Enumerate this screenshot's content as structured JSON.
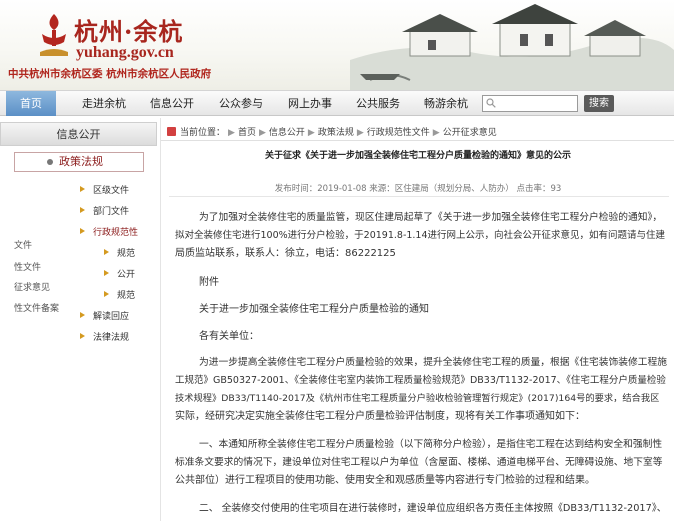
{
  "header": {
    "logo_title": "杭州·余杭",
    "logo_domain": "yuhang.gov.cn",
    "subtitle": "中共杭州市余杭区委  杭州市余杭区人民政府"
  },
  "nav": {
    "items": [
      "首页",
      "走进余杭",
      "信息公开",
      "公众参与",
      "网上办事",
      "公共服务",
      "畅游余杭"
    ],
    "search_button": "搜索"
  },
  "sidebar": {
    "title": "信息公开",
    "selected": "政策法规",
    "links": [
      "区级文件",
      "部门文件",
      "行政规范性",
      "规范",
      "公开",
      "规范",
      "解读回应",
      "法律法规"
    ],
    "partial_labels": [
      "文件",
      "性文件",
      "征求意见",
      "性文件备案"
    ]
  },
  "breadcrumb": {
    "prefix": "当前位置：",
    "items": [
      "首页",
      "信息公开",
      "政策法规",
      "行政规范性文件",
      "公开征求意见"
    ]
  },
  "article": {
    "title": "关于征求《关于进一步加强全装修住宅工程分户质量检验的通知》意见的公示",
    "meta": "发布时间：2019-01-08  来源：区住建局（规划分局、人防办）    点击率：93",
    "paragraphs": [
      "为了加强对全装修住宅的质量监管，现区住建局起草了《关于进一步加强全装修住宅工程分户检验的通知》，",
      "拟对全装修住宅进行100%进行分户检验，于20191.8-1.14进行网上公示，向社会公开征求意见，如有问题请与住建",
      "局质监站联系，联系人：徐立，电话：86222125",
      "附件",
      "关于进一步加强全装修住宅工程分户质量检验的通知",
      "各有关单位：",
      "为进一步提高全装修住宅工程分户质量检验的效果，提升全装修住宅工程的质量，根据《住宅装饰装修工程施",
      "工规范》GB50327-2001、《全装修住宅室内装饰工程质量检验规范》DB33/T1132-2017、《住宅工程分户质量检验",
      "技术规程》DB33/T1140-2017及《杭州市住宅工程质量分户验收检验管理暂行规定》(2017)164号的要求，结合我区",
      "实际，经研究决定实施全装修住宅工程分户质量检验评估制度，现将有关工作事项通知如下：",
      "一、本通知所称全装修住宅工程分户质量检验（以下简称分户检验），是指住宅工程在达到结构安全和强制性",
      "标准条文要求的情况下，建设单位对住宅工程以户为单位（含屋面、楼梯、通道电梯平台、无障碍设施、地下室等",
      "公共部位）进行工程项目的使用功能、使用安全和观感质量等内容进行专门检验的过程和结果。",
      "二、  全装修交付使用的住宅项目在进行装修时，建设单位应组织各方责任主体按照《DB33/T1132-2017》、"
    ]
  }
}
